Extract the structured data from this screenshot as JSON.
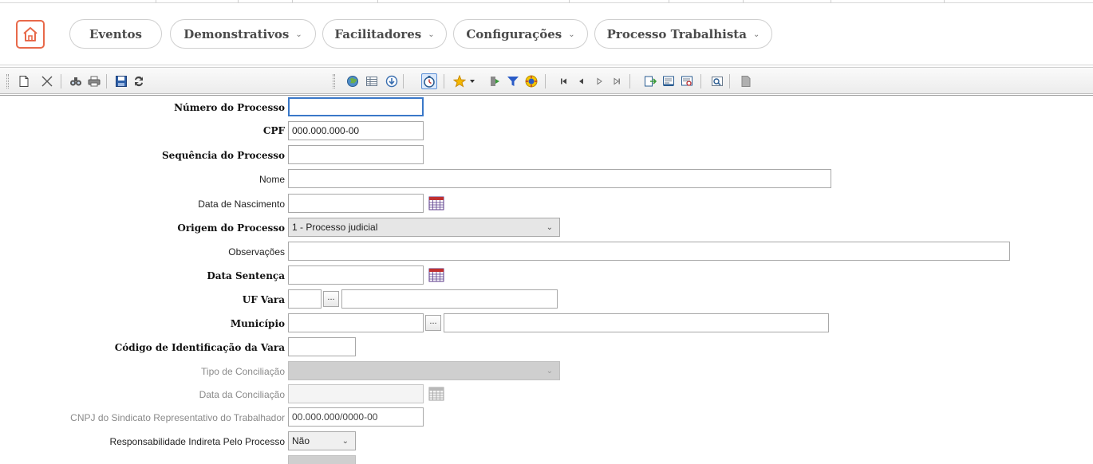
{
  "nav": {
    "home_icon": "home-icon",
    "accent_color": "#e8694a",
    "menus": [
      {
        "label": "Eventos",
        "has_dropdown": false
      },
      {
        "label": "Demonstrativos",
        "has_dropdown": true
      },
      {
        "label": "Facilitadores",
        "has_dropdown": true
      },
      {
        "label": "Configurações",
        "has_dropdown": true
      },
      {
        "label": "Processo Trabalhista",
        "has_dropdown": true
      }
    ]
  },
  "toolbar": {
    "left_icons": [
      "new-document-icon",
      "delete-icon",
      "find-icon",
      "print-icon",
      "save-icon",
      "refresh-icon"
    ],
    "right_icons": [
      "globe-icon",
      "grid-view-icon",
      "info-icon",
      "timer-icon",
      "favorite-icon",
      "exit-icon",
      "filter-icon",
      "help-icon",
      "first-record-icon",
      "previous-record-icon",
      "next-record-icon",
      "last-record-icon",
      "export-icon",
      "report-icon",
      "report-alt-icon",
      "preview-icon",
      "blank-page-icon"
    ]
  },
  "form": {
    "numero_processo": {
      "label": "Número do Processo",
      "value": ""
    },
    "cpf": {
      "label": "CPF",
      "value": "000.000.000-00"
    },
    "sequencia_processo": {
      "label": "Sequência do Processo",
      "value": ""
    },
    "nome": {
      "label": "Nome",
      "value": ""
    },
    "data_nascimento": {
      "label": "Data de Nascimento",
      "value": ""
    },
    "origem_processo": {
      "label": "Origem do Processo",
      "value": "1 - Processo judicial"
    },
    "observacoes": {
      "label": "Observações",
      "value": ""
    },
    "data_sentenca": {
      "label": "Data Sentença",
      "value": ""
    },
    "uf_vara": {
      "label": "UF Vara",
      "code": "",
      "description": "",
      "lookup_label": "..."
    },
    "municipio": {
      "label": "Município",
      "code": "",
      "description": "",
      "lookup_label": "..."
    },
    "codigo_vara": {
      "label": "Código de Identificação da Vara",
      "value": ""
    },
    "tipo_conciliacao": {
      "label": "Tipo de Conciliação",
      "value": ""
    },
    "data_conciliacao": {
      "label": "Data da Conciliação",
      "value": ""
    },
    "cnpj_sindicato": {
      "label": "CNPJ do Sindicato Representativo do Trabalhador",
      "value": "00.000.000/0000-00"
    },
    "responsabilidade_indireta": {
      "label": "Responsabilidade Indireta Pelo Processo",
      "value": "Não"
    }
  }
}
